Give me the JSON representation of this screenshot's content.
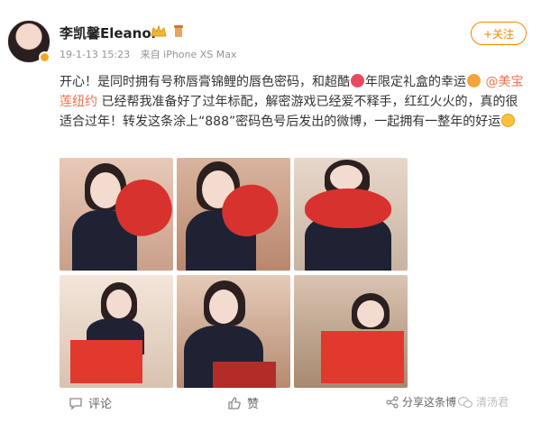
{
  "user": {
    "name": "李凯馨Eleanor",
    "time": "19-1-13 15:23",
    "source": "来自 iPhone XS Max"
  },
  "follow_label": "+关注",
  "post": {
    "part1": "开心！是同时拥有号称唇膏锦鲤的唇色密码，和超酷",
    "part2": "年限定礼盒的幸运",
    "mention": "@美宝莲纽约",
    "part3": "已经帮我准备好了过年标配，解密游戏已经爱不释手，红红火火的，真的很适合过年！转发这条涂上“888”密码色号后发出的微博，一起拥有一整年的好运"
  },
  "footer": {
    "comment_label": "评论",
    "like_label": "赞",
    "share_label": "分享这条博",
    "watermark": "清汤君"
  },
  "colors": {
    "accent": "#ff8200",
    "link": "#eb7350"
  }
}
